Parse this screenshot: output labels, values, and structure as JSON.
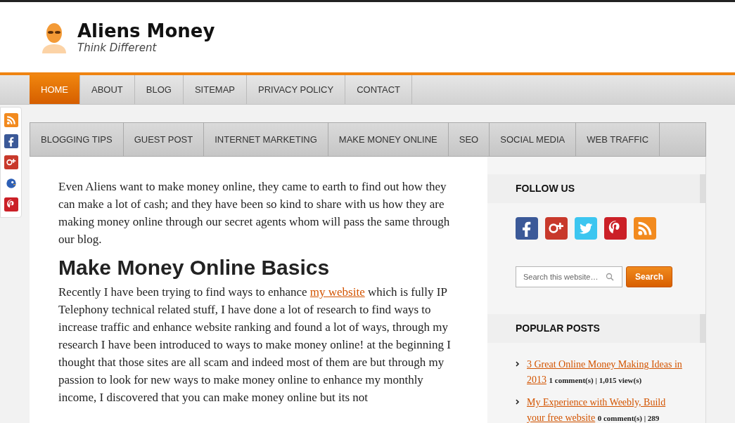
{
  "site": {
    "title": "Aliens Money",
    "tagline": "Think Different"
  },
  "main_nav": [
    {
      "label": "HOME",
      "selected": true
    },
    {
      "label": "ABOUT",
      "selected": false
    },
    {
      "label": "BLOG",
      "selected": false
    },
    {
      "label": "SITEMAP",
      "selected": false
    },
    {
      "label": "PRIVACY POLICY",
      "selected": false
    },
    {
      "label": "CONTACT",
      "selected": false
    }
  ],
  "social_bar": [
    {
      "kind": "rss"
    },
    {
      "kind": "facebook"
    },
    {
      "kind": "googleplus"
    },
    {
      "kind": "bird"
    },
    {
      "kind": "pinterest"
    }
  ],
  "category_nav": [
    "BLOGGING TIPS",
    "GUEST POST",
    "INTERNET MARKETING",
    "MAKE MONEY ONLINE",
    "SEO",
    "SOCIAL MEDIA",
    "WEB TRAFFIC"
  ],
  "article": {
    "intro": "Even Aliens want to make money online, they came to earth to find out how they can make a lot of cash; and they have been so kind to share with us how they are making money online through our secret agents whom will pass the same through our blog.",
    "heading": "Make Money Online Basics",
    "paragraph": {
      "before": "Recently I have been trying to find ways to enhance",
      "link": "my website",
      "after": "which is fully IP Telephony technical related stuff, I have done a lot of research to find ways to increase traffic and enhance website ranking and found a lot of ways, through my research I have been introduced to ways to make money online! at the beginning I thought that those sites are all scam and indeed most of them are but through my passion to look for new ways to make money online to enhance my monthly income, I discovered that you can make money online but its not"
    }
  },
  "sidebar": {
    "follow_title": "FOLLOW US",
    "follow_icons": [
      {
        "kind": "facebook"
      },
      {
        "kind": "googleplus"
      },
      {
        "kind": "twitter"
      },
      {
        "kind": "pinterest"
      },
      {
        "kind": "rss"
      }
    ],
    "search": {
      "placeholder": "Search this website…",
      "button": "Search"
    },
    "popular_title": "POPULAR POSTS",
    "popular_posts": [
      {
        "title": "3 Great Online Money Making Ideas in 2013",
        "meta": "1 comment(s) | 1,015 view(s)"
      },
      {
        "title": "My Experience with Weebly, Build your free website",
        "meta": "0 comment(s) | 289"
      }
    ]
  }
}
